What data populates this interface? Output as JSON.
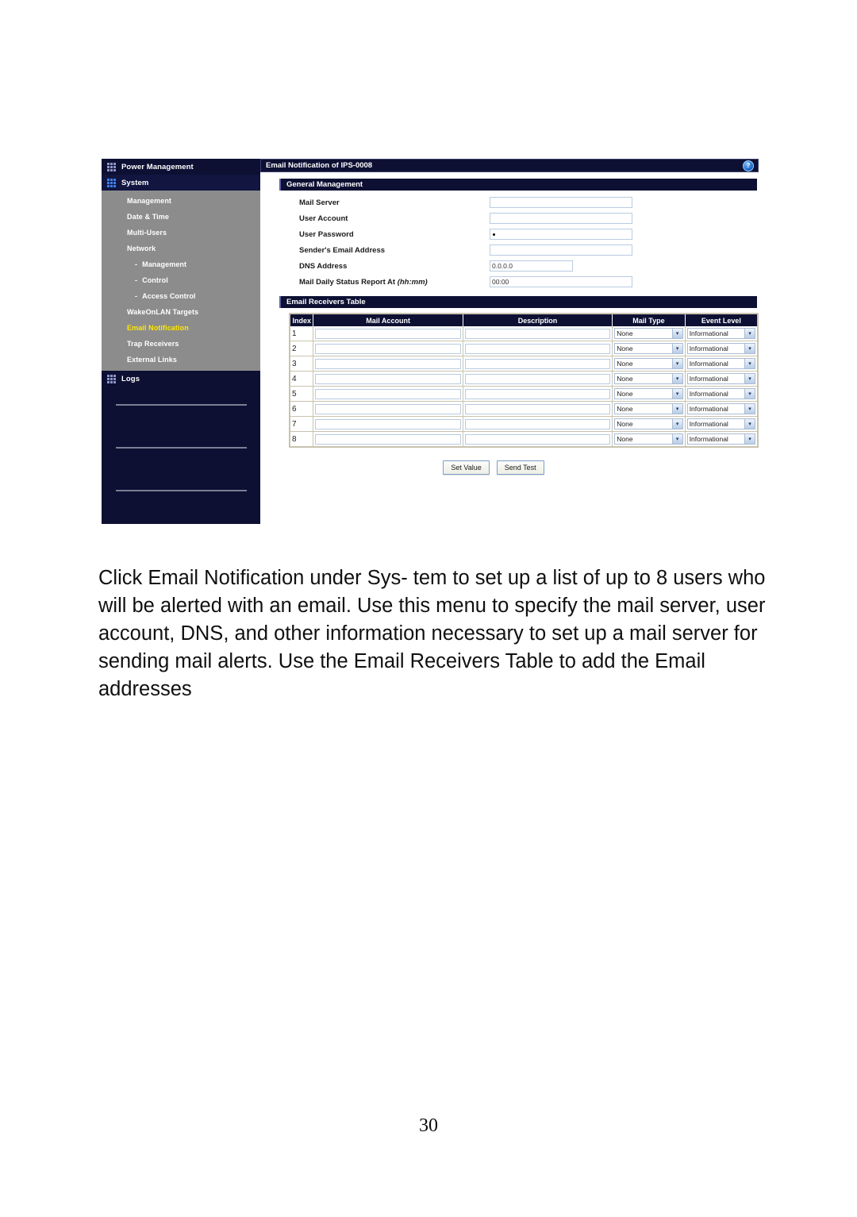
{
  "document": {
    "page_number": "30",
    "body_text": "Click Email Notification under Sys- tem to set up a list of up to 8 users who will be alerted with an email. Use this menu to specify the mail server, user account, DNS, and other information necessary to set up a mail server for sending mail alerts. Use the Email Receivers Table to add the Email addresses"
  },
  "screenshot": {
    "sidebar": {
      "top_items": [
        {
          "label": "Power Management",
          "icon": "dot-grid-icon",
          "selected": false
        },
        {
          "label": "System",
          "icon": "dot-grid-icon",
          "selected": true
        }
      ],
      "sub_items": [
        {
          "label": "Management",
          "indent": false,
          "active": false
        },
        {
          "label": "Date & Time",
          "indent": false,
          "active": false
        },
        {
          "label": "Multi-Users",
          "indent": false,
          "active": false
        },
        {
          "label": "Network",
          "indent": false,
          "active": false
        },
        {
          "label": "Management",
          "indent": true,
          "active": false
        },
        {
          "label": "Control",
          "indent": true,
          "active": false
        },
        {
          "label": "Access Control",
          "indent": true,
          "active": false
        },
        {
          "label": "WakeOnLAN Targets",
          "indent": false,
          "active": false
        },
        {
          "label": "Email Notification",
          "indent": false,
          "active": true
        },
        {
          "label": "Trap Receivers",
          "indent": false,
          "active": false
        },
        {
          "label": "External Links",
          "indent": false,
          "active": false
        }
      ],
      "logs_item": {
        "label": "Logs",
        "icon": "dot-grid-icon"
      },
      "active_color": "#ffe800",
      "background_color": "#0d1033",
      "submenu_background_color": "#8c8c8c"
    },
    "titlebar": {
      "title": "Email Notification of IPS-0008",
      "help_icon": "help-question-icon",
      "help_glyph": "?"
    },
    "general_management": {
      "section_title": "General Management",
      "fields": [
        {
          "label": "Mail Server",
          "label_italic": "",
          "value": "",
          "width": "wide",
          "type": "text"
        },
        {
          "label": "User Account",
          "label_italic": "",
          "value": "",
          "width": "wide",
          "type": "text"
        },
        {
          "label": "User Password",
          "label_italic": "",
          "value": "",
          "width": "wide",
          "type": "password"
        },
        {
          "label": "Sender's Email Address",
          "label_italic": "",
          "value": "",
          "width": "wide",
          "type": "text"
        },
        {
          "label": "DNS Address",
          "label_italic": "",
          "value": "0.0.0.0",
          "width": "narrow",
          "type": "text"
        },
        {
          "label": "Mail Daily Status Report At ",
          "label_italic": "(hh:mm)",
          "value": "00:00",
          "width": "wide",
          "type": "text"
        }
      ]
    },
    "receivers_table": {
      "section_title": "Email Receivers Table",
      "columns": [
        "Index",
        "Mail Account",
        "Description",
        "Mail Type",
        "Event Level"
      ],
      "rows": [
        {
          "index": "1",
          "mail_account": "",
          "description": "",
          "mail_type": "None",
          "event_level": "Informational"
        },
        {
          "index": "2",
          "mail_account": "",
          "description": "",
          "mail_type": "None",
          "event_level": "Informational"
        },
        {
          "index": "3",
          "mail_account": "",
          "description": "",
          "mail_type": "None",
          "event_level": "Informational"
        },
        {
          "index": "4",
          "mail_account": "",
          "description": "",
          "mail_type": "None",
          "event_level": "Informational"
        },
        {
          "index": "5",
          "mail_account": "",
          "description": "",
          "mail_type": "None",
          "event_level": "Informational"
        },
        {
          "index": "6",
          "mail_account": "",
          "description": "",
          "mail_type": "None",
          "event_level": "Informational"
        },
        {
          "index": "7",
          "mail_account": "",
          "description": "",
          "mail_type": "None",
          "event_level": "Informational"
        },
        {
          "index": "8",
          "mail_account": "",
          "description": "",
          "mail_type": "None",
          "event_level": "Informational"
        }
      ]
    },
    "buttons": [
      {
        "label": "Set Value",
        "name": "set-value-button"
      },
      {
        "label": "Send Test",
        "name": "send-test-button"
      }
    ]
  }
}
